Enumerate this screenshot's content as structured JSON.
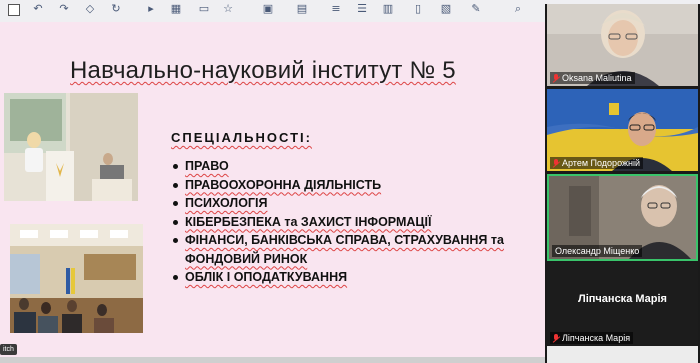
{
  "slide": {
    "title": "Навчально-науковий інститут № 5",
    "heading": "СПЕЦІАЛЬНОСТІ:",
    "specialties": [
      "ПРАВО",
      "ПРАВООХОРОННА ДІЯЛЬНІСТЬ",
      "ПСИХОЛОГІЯ",
      "КІБЕРБЕЗПЕКА та ЗАХИСТ ІНФОРМАЦІЇ",
      "ФІНАНСИ, БАНКІВСЬКА СПРАВА, СТРАХУВАННЯ та ФОНДОВИЙ РИНОК",
      "ОБЛІК І ОПОДАТКУВАННЯ"
    ],
    "badge": "itch"
  },
  "participants": [
    {
      "name": "Oksana Malіutina",
      "muted": true
    },
    {
      "name": "Артем Подорожній",
      "muted": true
    },
    {
      "name": "Олександр Міщенко",
      "muted": false,
      "active_speaker": true
    },
    {
      "name": "Ліпчанска Марія",
      "muted": true,
      "video_off": true,
      "center_label": "Ліпчанска Марія"
    }
  ],
  "colors": {
    "slide_background": "#f9e5f0",
    "active_speaker_border": "#39c46a",
    "muted_mic": "#e33333"
  }
}
